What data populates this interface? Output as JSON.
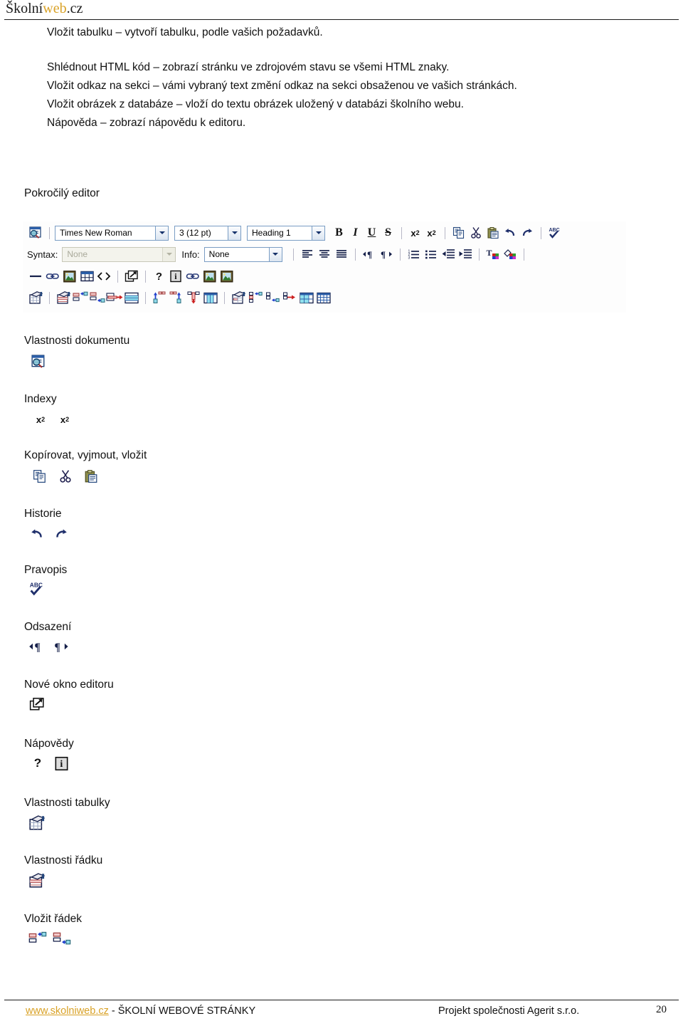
{
  "header": {
    "brand_prefix": "Školní",
    "brand_highlight": "web",
    "brand_suffix": ".cz",
    "brand_highlight_color": "#d9a227"
  },
  "intro": {
    "lines": [
      "Vložit tabulku – vytvoří tabulku, podle vašich požadavků.",
      "Shlédnout HTML kód – zobrazí stránku ve zdrojovém stavu se všemi HTML znaky.",
      "Vložit odkaz na sekci – vámi vybraný text změní odkaz na sekci obsaženou ve vašich stránkách.",
      "Vložit obrázek z databáze – vloží do textu obrázek uložený v databázi školního webu.",
      "Nápověda – zobrazí nápovědu k editoru."
    ]
  },
  "sections": {
    "advanced_editor": "Pokročilý editor",
    "document_properties": "Vlastnosti dokumentu",
    "indexes": "Indexy",
    "copy_cut_paste": "Kopírovat, vyjmout, vložit",
    "history": "Historie",
    "spelling": "Pravopis",
    "indent": "Odsazení",
    "new_editor_window": "Nové okno editoru",
    "help": "Nápovědy",
    "table_properties": "Vlastnosti tabulky",
    "row_properties": "Vlastnosti řádku",
    "insert_row": "Vložit řádek"
  },
  "toolbar": {
    "font_family": "Times New Roman",
    "font_size": "3 (12 pt)",
    "paragraph_style": "Heading 1",
    "syntax_label": "Syntax:",
    "syntax_value": "None",
    "info_label": "Info:",
    "info_value": "None",
    "bold": "B",
    "italic": "I",
    "underline": "U",
    "strikethrough": "S",
    "subscript_base": "x",
    "subscript_index": "2",
    "superscript_base": "x",
    "superscript_index": "2",
    "help_question": "?",
    "help_info": "i"
  },
  "footer": {
    "link": "www.skolniweb.cz",
    "separator": " - ",
    "site_title": "ŠKOLNÍ WEBOVÉ STRÁNKY",
    "project": "Projekt společnosti Agerit s.r.o.",
    "page_number": "20",
    "link_color": "#d9a227"
  }
}
